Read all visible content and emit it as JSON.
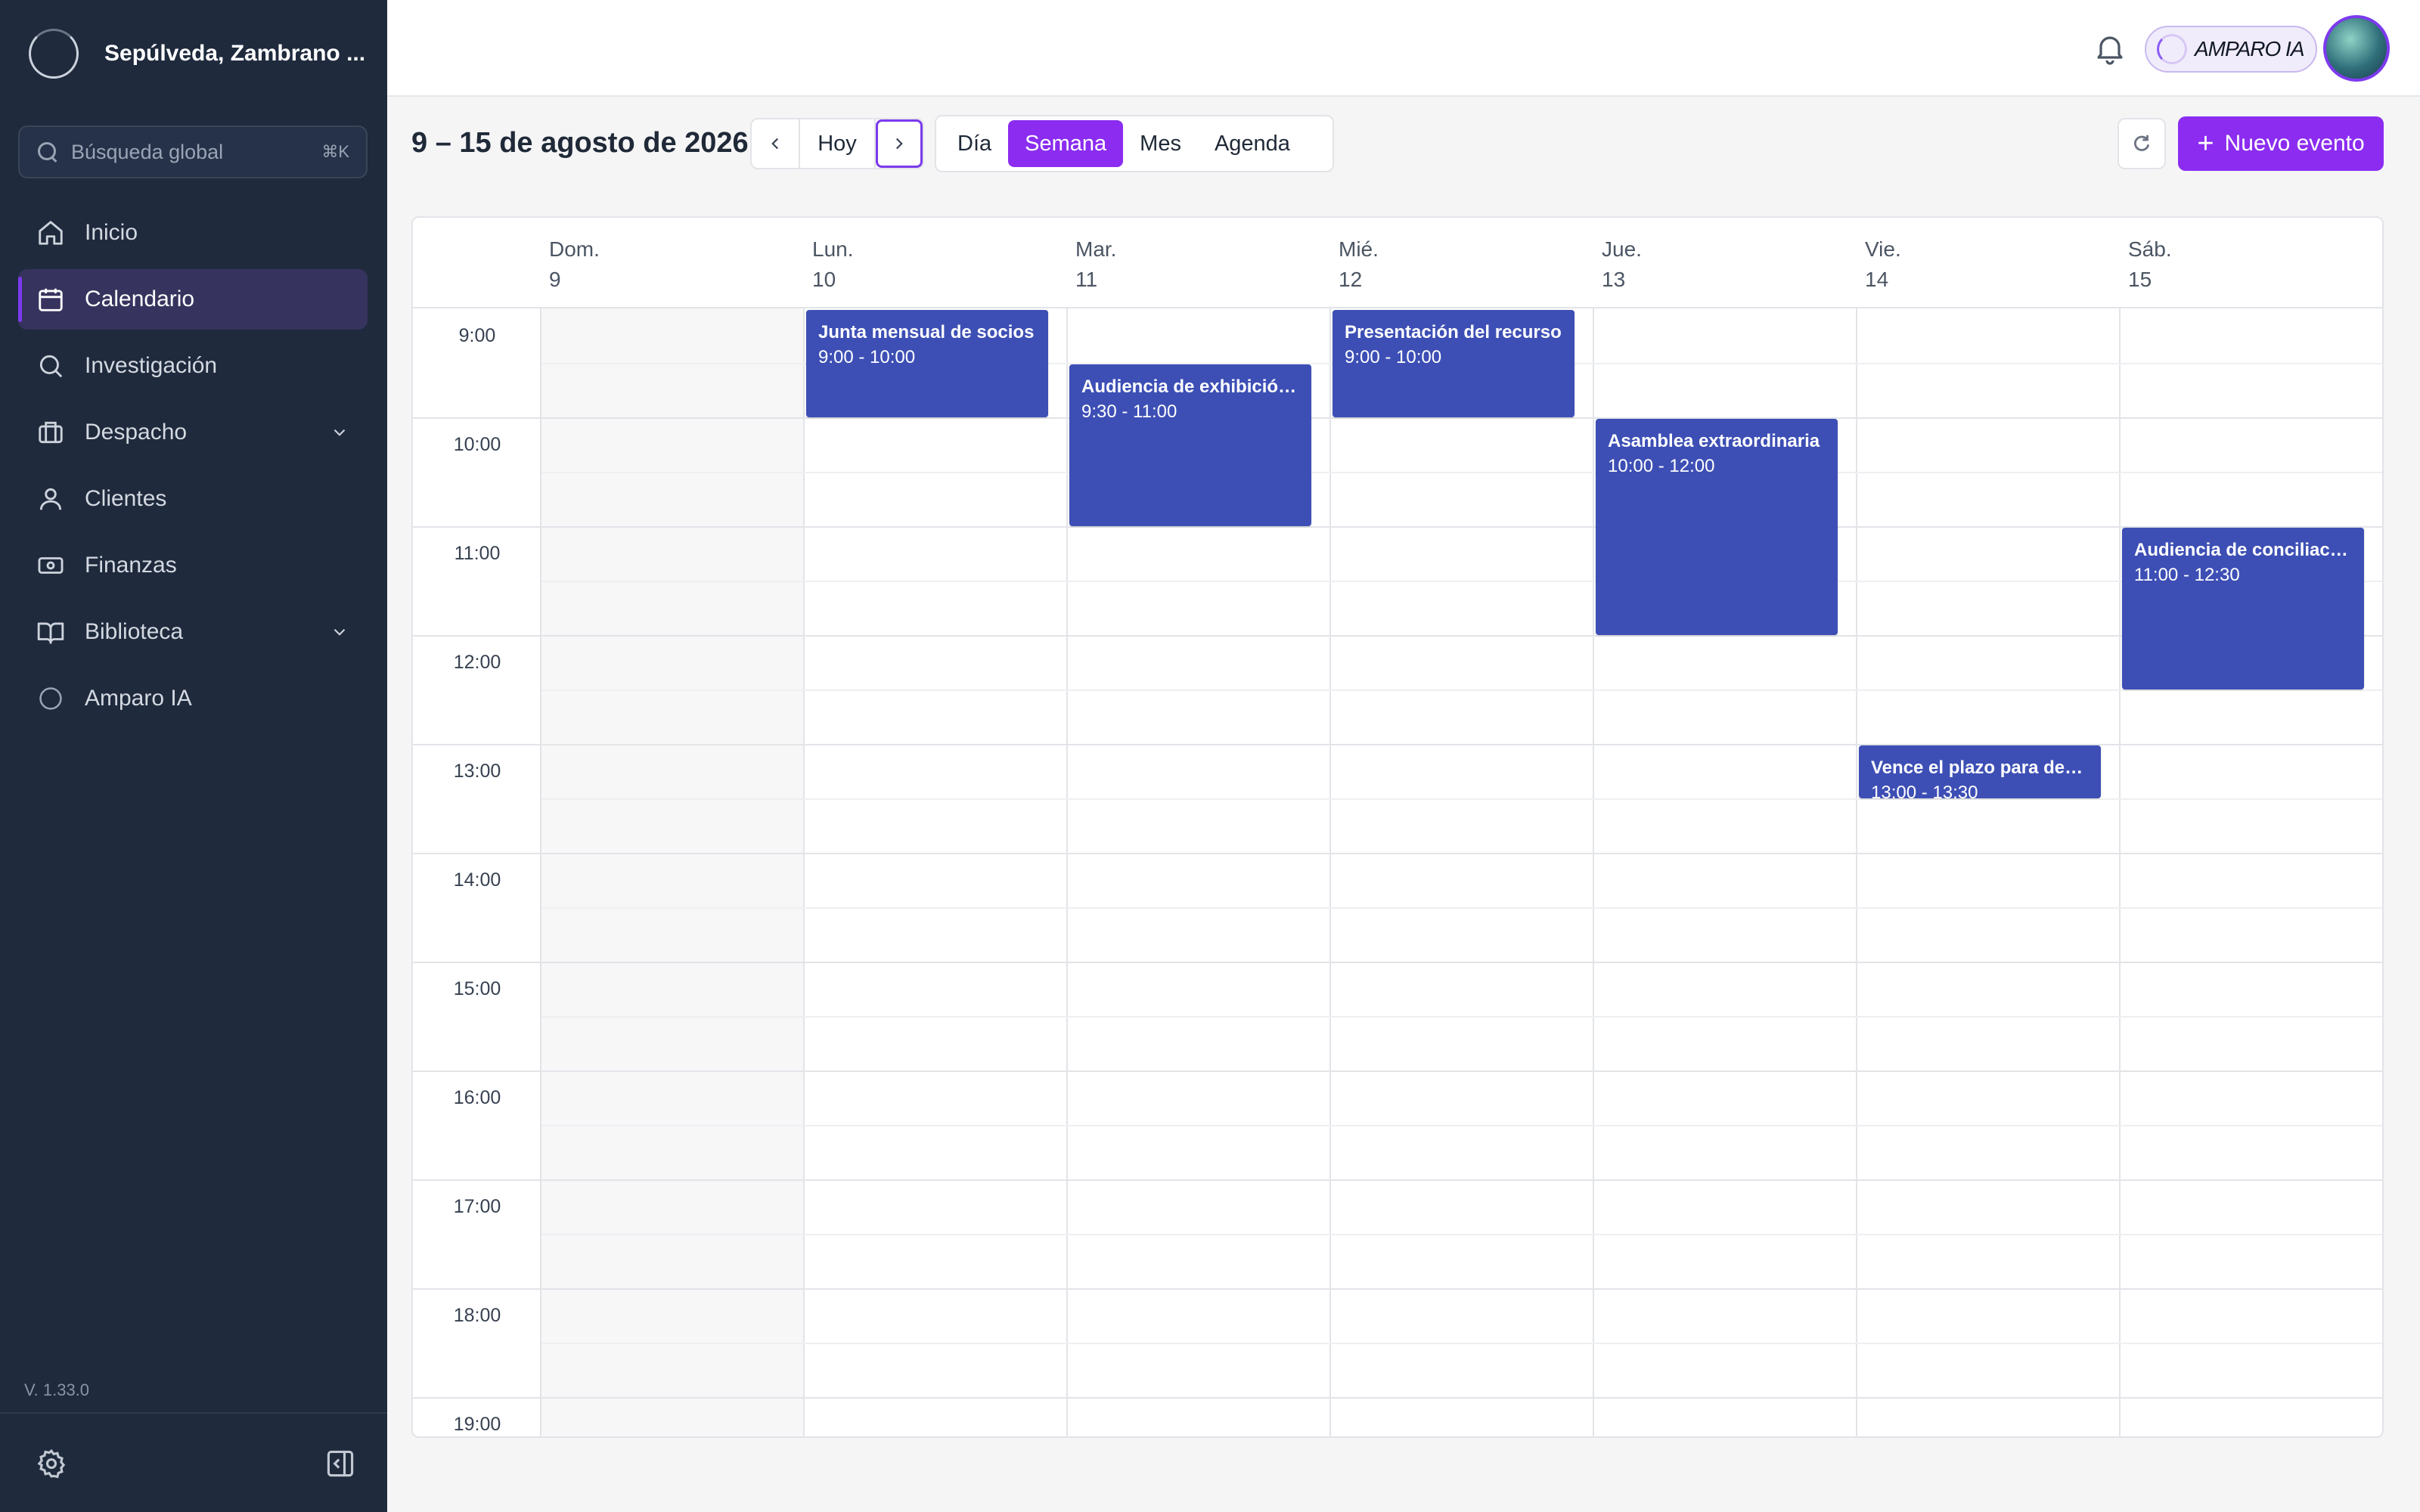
{
  "sidebar": {
    "org_name": "Sepúlveda, Zambrano ...",
    "search_placeholder": "Búsqueda global",
    "search_shortcut": "⌘K",
    "items": [
      {
        "label": "Inicio",
        "icon": "home-icon"
      },
      {
        "label": "Calendario",
        "icon": "calendar-icon",
        "active": true
      },
      {
        "label": "Investigación",
        "icon": "search-icon"
      },
      {
        "label": "Despacho",
        "icon": "briefcase-icon",
        "expandable": true
      },
      {
        "label": "Clientes",
        "icon": "user-icon"
      },
      {
        "label": "Finanzas",
        "icon": "banknote-icon"
      },
      {
        "label": "Biblioteca",
        "icon": "book-icon",
        "expandable": true
      },
      {
        "label": "Amparo IA",
        "icon": "circle-icon"
      }
    ],
    "version": "V. 1.33.0"
  },
  "topbar": {
    "assistant_label": "AMPARO IA"
  },
  "toolbar": {
    "range_title": "9 – 15 de agosto de 2026",
    "today_label": "Hoy",
    "views": [
      "Día",
      "Semana",
      "Mes",
      "Agenda"
    ],
    "active_view": "Semana",
    "new_event_label": "Nuevo evento"
  },
  "calendar": {
    "days": [
      {
        "name": "Dom.",
        "number": "9"
      },
      {
        "name": "Lun.",
        "number": "10"
      },
      {
        "name": "Mar.",
        "number": "11"
      },
      {
        "name": "Mié.",
        "number": "12"
      },
      {
        "name": "Jue.",
        "number": "13"
      },
      {
        "name": "Vie.",
        "number": "14"
      },
      {
        "name": "Sáb.",
        "number": "15"
      }
    ],
    "hours": [
      "9:00",
      "10:00",
      "11:00",
      "12:00",
      "13:00",
      "14:00",
      "15:00",
      "16:00",
      "17:00",
      "18:00",
      "19:00"
    ],
    "events": [
      {
        "day": 1,
        "start": 9.0,
        "end": 10.0,
        "title": "Junta mensual de socios",
        "time": "9:00 - 10:00"
      },
      {
        "day": 2,
        "start": 9.5,
        "end": 11.0,
        "title": "Audiencia de exhibición de documentos",
        "time": "9:30 - 11:00"
      },
      {
        "day": 3,
        "start": 9.0,
        "end": 10.0,
        "title": "Presentación del recurso",
        "time": "9:00 - 10:00"
      },
      {
        "day": 4,
        "start": 10.0,
        "end": 12.0,
        "title": "Asamblea extraordinaria",
        "time": "10:00 - 12:00"
      },
      {
        "day": 6,
        "start": 11.0,
        "end": 12.5,
        "title": "Audiencia de conciliación",
        "time": "11:00 - 12:30"
      },
      {
        "day": 5,
        "start": 13.0,
        "end": 13.5,
        "title": "Vence el plazo para demanda",
        "time": "13:00 - 13:30"
      }
    ]
  },
  "colors": {
    "sidebar_bg": "#1f2a3d",
    "accent": "#8b2cf0",
    "event_bg": "#3d4fb5"
  }
}
